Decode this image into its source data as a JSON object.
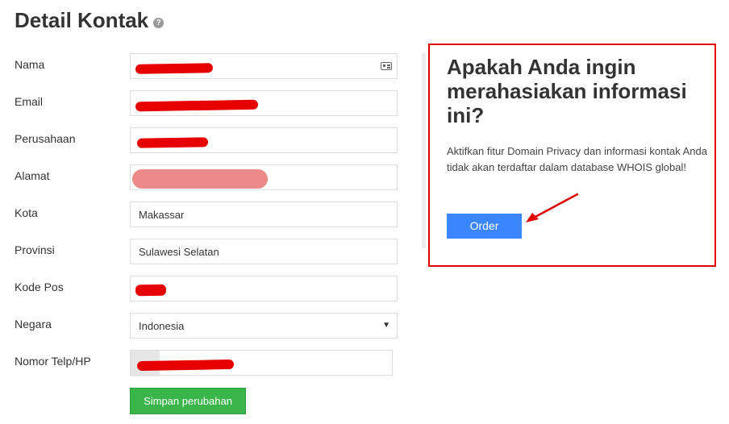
{
  "page": {
    "title": "Detail Kontak",
    "help_icon": "question-circle-icon"
  },
  "form": {
    "fields": [
      {
        "label": "Nama",
        "value": ""
      },
      {
        "label": "Email",
        "value": ""
      },
      {
        "label": "Perusahaan",
        "value": ""
      },
      {
        "label": "Alamat",
        "value": ""
      },
      {
        "label": "Kota",
        "value": "Makassar"
      },
      {
        "label": "Provinsi",
        "value": "Sulawesi Selatan"
      },
      {
        "label": "Kode Pos",
        "value": ""
      },
      {
        "label": "Negara",
        "value": "Indonesia"
      },
      {
        "label": "Nomor Telp/HP",
        "value": ""
      }
    ],
    "save_label": "Simpan perubahan",
    "redaction_color": "#e60000",
    "save_color": "#3ab54a"
  },
  "privacy": {
    "title": "Apakah Anda ingin merahasiakan informasi ini?",
    "description": "Aktifkan fitur Domain Privacy dan informasi kontak Anda tidak akan terdaftar dalam database WHOIS global!",
    "order_label": "Order",
    "order_color": "#3a86ff",
    "highlight_color": "#e00000"
  }
}
